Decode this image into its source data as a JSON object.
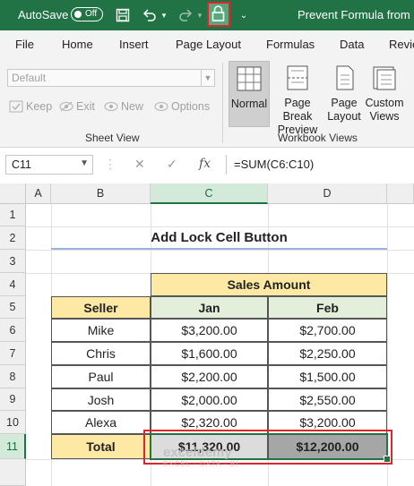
{
  "titlebar": {
    "autosave_label": "AutoSave",
    "toggle_state": "Off",
    "title": "Prevent Formula from Be"
  },
  "menu": [
    "File",
    "Home",
    "Insert",
    "Page Layout",
    "Formulas",
    "Data",
    "Revie"
  ],
  "ribbon": {
    "sheet_view": {
      "select_value": "Default",
      "buttons": [
        "Keep",
        "Exit",
        "New",
        "Options"
      ],
      "group_label": "Sheet View"
    },
    "workbook_views": {
      "buttons": [
        {
          "label": "Normal",
          "active": true
        },
        {
          "label": "Page Break Preview"
        },
        {
          "label": "Page Layout"
        },
        {
          "label": "Custom Views"
        }
      ],
      "group_label": "Workbook Views"
    }
  },
  "formula_bar": {
    "name_box": "C11",
    "formula": "=SUM(C6:C10)"
  },
  "columns": [
    "A",
    "B",
    "C",
    "D"
  ],
  "rows": [
    "1",
    "2",
    "3",
    "4",
    "5",
    "6",
    "7",
    "8",
    "9",
    "10",
    "11"
  ],
  "sheet": {
    "title": "Add Lock Cell Button",
    "sales_amount": "Sales Amount",
    "headers": {
      "seller": "Seller",
      "jan": "Jan",
      "feb": "Feb"
    },
    "data": [
      {
        "seller": "Mike",
        "jan": "$3,200.00",
        "feb": "$2,700.00"
      },
      {
        "seller": "Chris",
        "jan": "$1,600.00",
        "feb": "$2,250.00"
      },
      {
        "seller": "Paul",
        "jan": "$2,200.00",
        "feb": "$1,500.00"
      },
      {
        "seller": "Josh",
        "jan": "$2,000.00",
        "feb": "$2,550.00"
      },
      {
        "seller": "Alexa",
        "jan": "$2,320.00",
        "feb": "$3,200.00"
      }
    ],
    "total": {
      "label": "Total",
      "jan": "$11,320.00",
      "feb": "$12,200.00"
    }
  },
  "watermark": {
    "brand": "exceldemy",
    "tagline": "EXCEL · DATA · BI"
  },
  "colors": {
    "excel_green": "#217346",
    "header_yellow": "#fde9a3",
    "header_green": "#e3efda",
    "highlight_red": "#e0242b",
    "selected_gray": "#a6a6a6"
  }
}
